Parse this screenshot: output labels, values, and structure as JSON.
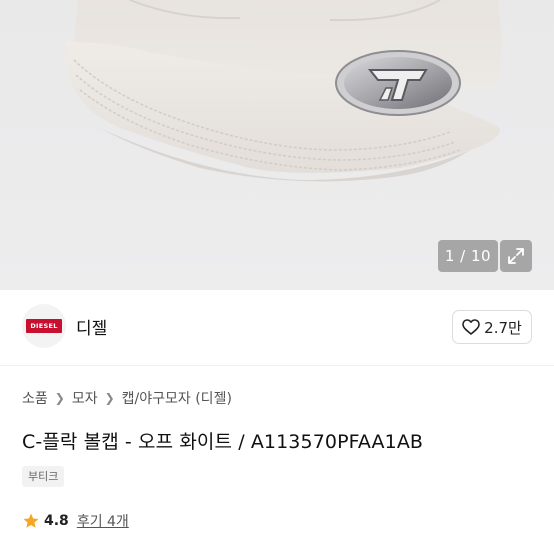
{
  "gallery": {
    "counter": "1 / 10"
  },
  "brand": {
    "logo_text": "DIESEL",
    "name": "디젤",
    "likes": "2.7만"
  },
  "breadcrumb": [
    "소품",
    "모자",
    "캡/야구모자 (디젤)"
  ],
  "product": {
    "title": "C-플락 볼캡 - 오프 화이트 / A113570PFAA1AB",
    "tag": "부티크"
  },
  "rating": {
    "score": "4.8",
    "reviews": "후기 4개"
  },
  "colors": {
    "star": "#f5a623",
    "brand_red": "#c8102e"
  }
}
